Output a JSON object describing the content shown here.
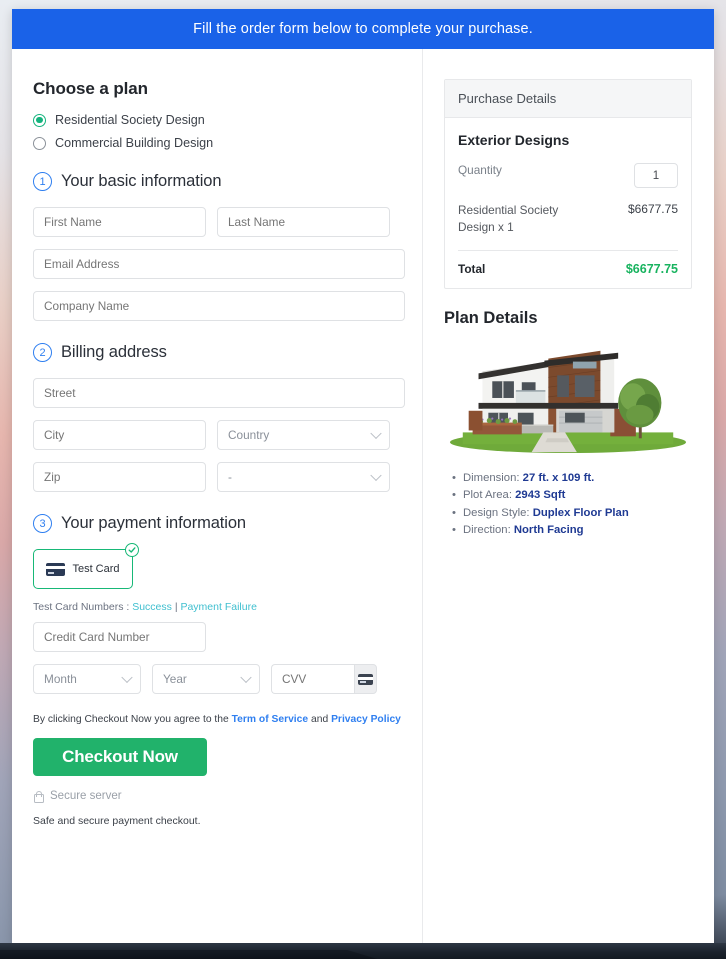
{
  "banner": {
    "text": "Fill the order form below to complete your purchase."
  },
  "plan": {
    "heading": "Choose a plan",
    "options": [
      {
        "label": "Residential Society Design",
        "selected": true
      },
      {
        "label": "Commercial Building Design",
        "selected": false
      }
    ]
  },
  "steps": {
    "basic": {
      "num": "1",
      "title": "Your basic information"
    },
    "billing": {
      "num": "2",
      "title": "Billing address"
    },
    "payment": {
      "num": "3",
      "title": "Your payment information"
    }
  },
  "fields": {
    "first_name": "First Name",
    "last_name": "Last Name",
    "email": "Email Address",
    "company": "Company Name",
    "street": "Street",
    "city": "City",
    "country": "Country",
    "zip": "Zip",
    "state": "-",
    "card_number": "Credit Card Number",
    "month": "Month",
    "year": "Year",
    "cvv": "CVV"
  },
  "payment": {
    "tile_label": "Test  Card",
    "tile_selected": true,
    "test_numbers_prefix": "Test Card Numbers :",
    "link_success": "Success",
    "link_separator": "|",
    "link_failure": "Payment Failure"
  },
  "checkout": {
    "terms_prefix": "By clicking Checkout Now you agree to the",
    "terms_link": "Term of Service",
    "terms_and": "and",
    "privacy_link": "Privacy Policy",
    "button_label": "Checkout Now",
    "secure_server": "Secure server",
    "safe_note": "Safe and secure payment checkout."
  },
  "purchase": {
    "panel_header": "Purchase Details",
    "product_title": "Exterior Designs",
    "quantity_label": "Quantity",
    "quantity_value": "1",
    "item_name": "Residential Society Design x 1",
    "item_price": "$6677.75",
    "total_label": "Total",
    "total_value": "$6677.75"
  },
  "plan_details": {
    "heading": "Plan Details",
    "items": [
      {
        "label": "Dimension:",
        "value": "27 ft. x 109 ft."
      },
      {
        "label": "Plot Area:",
        "value": "2943 Sqft"
      },
      {
        "label": "Design Style:",
        "value": "Duplex Floor Plan"
      },
      {
        "label": "Direction:",
        "value": "North Facing"
      }
    ]
  },
  "colors": {
    "banner_blue": "#1a62e8",
    "accent_green": "#21b26b",
    "step_blue": "#2f7ff0",
    "link_teal": "#3fbfcf",
    "total_green": "#18b35f"
  }
}
